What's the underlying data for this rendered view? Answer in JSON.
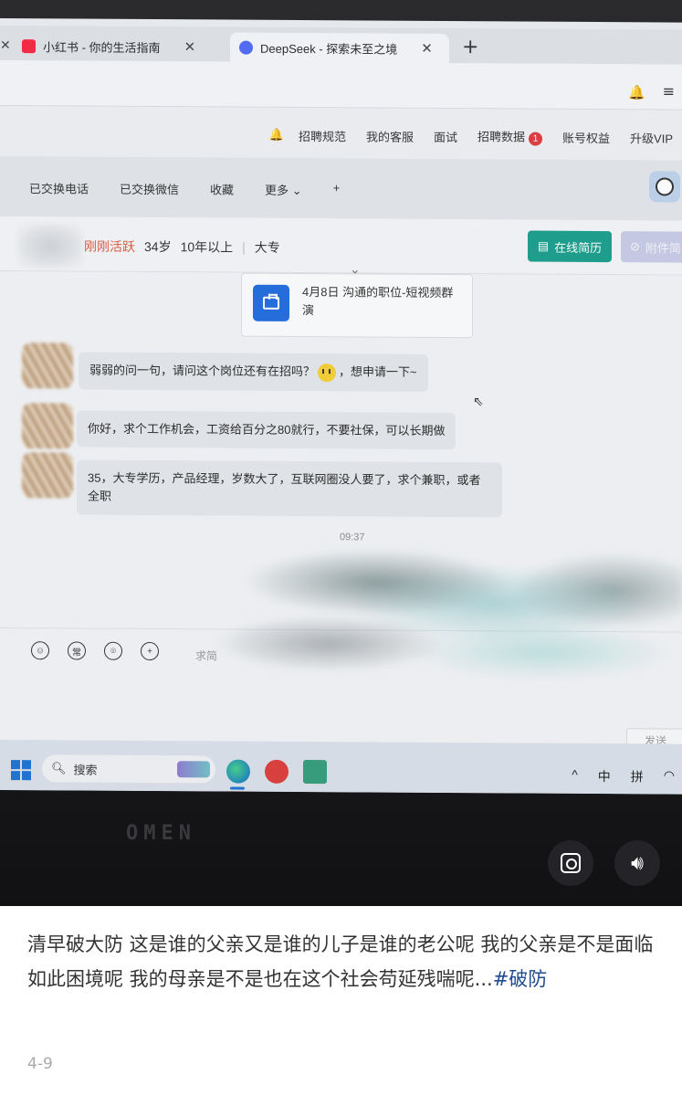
{
  "browser": {
    "tabs": [
      {
        "title": "小红书 - 你的生活指南",
        "favicon_color": "#ff2442"
      },
      {
        "title": "DeepSeek - 探索未至之境",
        "favicon_color": "#4d6bfe"
      }
    ]
  },
  "site_nav": {
    "items": [
      "招聘规范",
      "我的客服",
      "面试",
      "招聘数据",
      "账号权益",
      "升级VIP"
    ],
    "recruit_data_badge": "1"
  },
  "chat_tabs": [
    "已交换电话",
    "已交换微信",
    "收藏",
    "更多"
  ],
  "candidate": {
    "status": "刚刚活跃",
    "age": "34岁",
    "experience": "10年以上",
    "education": "大专",
    "resume_button": "在线简历",
    "attachment_button": "附件简"
  },
  "job_card": {
    "text": "4月8日 沟通的职位-短视频群演"
  },
  "messages": [
    {
      "before_emoji": "弱弱的问一句，请问这个岗位还有在招吗？",
      "after_emoji": "，想申请一下~"
    },
    {
      "text": "你好，求个工作机会，工资给百分之80就行，不要社保，可以长期做"
    },
    {
      "text": "35，大专学历，产品经理，岁数大了，互联网圈没人要了，求个兼职，或者全职"
    }
  ],
  "timestamp": "09:37",
  "composer": {
    "hint": "求简",
    "send_label": "发送",
    "tool_icons": [
      "emoji-icon",
      "common-phrase-icon",
      "location-icon",
      "plus-icon"
    ],
    "common_label": "常"
  },
  "taskbar": {
    "search_label": "搜索",
    "tray": [
      "^",
      "中",
      "拼"
    ]
  },
  "bezel_brand": "OMEN",
  "post": {
    "body": "清早破大防 这是谁的父亲又是谁的儿子是谁的老公呢 我的父亲是不是面临如此困境呢 我的母亲是不是也在这个社会苟延残喘呢...",
    "hashtag": "#破防",
    "date": "4-9"
  }
}
